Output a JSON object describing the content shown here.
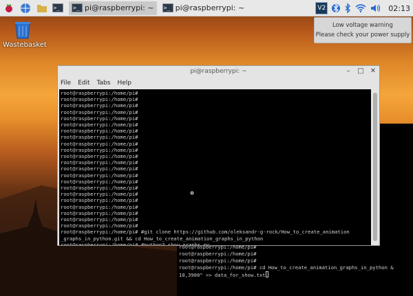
{
  "taskbar": {
    "tasks": [
      {
        "label": "pi@raspberrypi: ~",
        "icon": "terminal-icon"
      },
      {
        "label": "pi@raspberrypi: ~",
        "icon": "terminal-icon"
      }
    ],
    "clock": "02:13",
    "tray_icons": [
      "vnc-icon",
      "bluetooth-icon",
      "bluetooth-icon",
      "wifi-icon",
      "volume-icon"
    ]
  },
  "desktop": {
    "icon_label": "Wastebasket"
  },
  "notification": {
    "line1": "Low voltage warning",
    "line2": "Please check your power supply"
  },
  "window": {
    "title": "pi@raspberrypi: ~",
    "menu": [
      "File",
      "Edit",
      "Tabs",
      "Help"
    ],
    "lines": [
      "root@raspberrypi:/home/pi#",
      "root@raspberrypi:/home/pi#",
      "root@raspberrypi:/home/pi#",
      "root@raspberrypi:/home/pi#",
      "root@raspberrypi:/home/pi#",
      "root@raspberrypi:/home/pi#",
      "root@raspberrypi:/home/pi#",
      "root@raspberrypi:/home/pi#",
      "root@raspberrypi:/home/pi#",
      "root@raspberrypi:/home/pi#",
      "root@raspberrypi:/home/pi#",
      "root@raspberrypi:/home/pi#",
      "root@raspberrypi:/home/pi#",
      "root@raspberrypi:/home/pi#",
      "root@raspberrypi:/home/pi#",
      "root@raspberrypi:/home/pi#",
      "root@raspberrypi:/home/pi#",
      "root@raspberrypi:/home/pi#",
      "root@raspberrypi:/home/pi#",
      "root@raspberrypi:/home/pi#",
      "root@raspberrypi:/home/pi#",
      "root@raspberrypi:/home/pi#",
      "root@raspberrypi:/home/pi# #git clone https://github.com/oleksandr-g-rock/How_to_create_animation",
      "_graphs_in_python.git && cd How_to_create_animation_graphs_in_python",
      "root@raspberrypi:/home/pi# #python3 show_graphs.py",
      "root@raspberrypi:/home/pi# "
    ]
  },
  "back_window": {
    "lines": [
      "root@raspberrypi:/home/pi#",
      "root@raspberrypi:/home/pi#",
      "root@raspberrypi:/home/pi#",
      "root@raspberrypi:/home/pi# cd How_to_create_animation_graphs_in_python &",
      "10,3900\" >> data_for_show.txt"
    ]
  }
}
